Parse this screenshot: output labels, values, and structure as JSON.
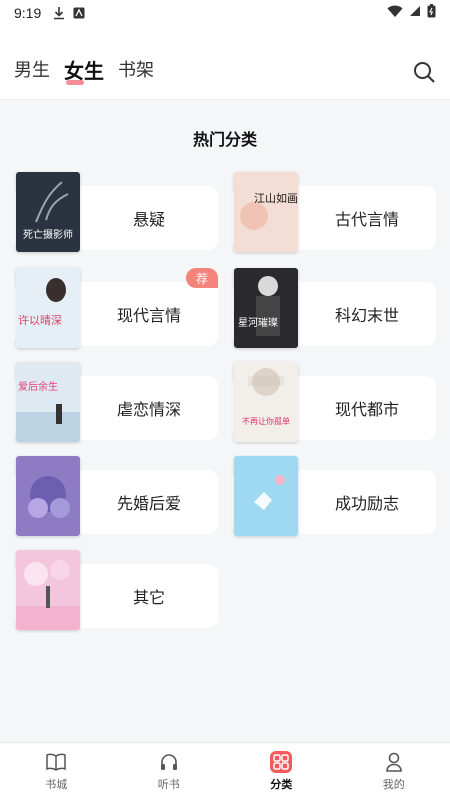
{
  "status": {
    "time": "9:19"
  },
  "header": {
    "tabs": [
      {
        "label": "男生"
      },
      {
        "label": "女生",
        "active": true
      },
      {
        "label": "书架"
      }
    ]
  },
  "section": {
    "title": "热门分类"
  },
  "categories": [
    {
      "label": "悬疑"
    },
    {
      "label": "古代言情"
    },
    {
      "label": "现代言情",
      "badge": "荐"
    },
    {
      "label": "科幻末世"
    },
    {
      "label": "虐恋情深"
    },
    {
      "label": "现代都市"
    },
    {
      "label": "先婚后爱"
    },
    {
      "label": "成功励志"
    },
    {
      "label": "其它"
    }
  ],
  "covers": [
    {
      "title": "死亡摄影师",
      "bg": "#2b3340",
      "fg": "#ffffff"
    },
    {
      "title": "江山如画",
      "bg": "#f3ddd4",
      "fg": "#1a1a1a"
    },
    {
      "title": "许以晴深",
      "bg": "#e6eef6",
      "fg": "#d9416a"
    },
    {
      "title": "星河璀璨",
      "bg": "#2a2a2e",
      "fg": "#ffffff"
    },
    {
      "title": "爱后余生",
      "bg": "#dfe9f1",
      "fg": "#e0447a"
    },
    {
      "title": "不再让你孤单",
      "bg": "#f2eeea",
      "fg": "#e0306a"
    },
    {
      "title": "",
      "bg": "#8d7bc4",
      "fg": "#ffffff"
    },
    {
      "title": "",
      "bg": "#9fd8f1",
      "fg": "#ffffff"
    },
    {
      "title": "",
      "bg": "#f4c6dd",
      "fg": "#ffffff"
    }
  ],
  "nav": [
    {
      "label": "书城",
      "icon": "book-icon"
    },
    {
      "label": "听书",
      "icon": "headphones-icon"
    },
    {
      "label": "分类",
      "icon": "grid-icon",
      "active": true
    },
    {
      "label": "我的",
      "icon": "user-icon"
    }
  ],
  "colors": {
    "accent": "#f25b5b",
    "tabUnderline": "#f07a85",
    "badge": "#f4837b",
    "background": "#f5f6f8"
  }
}
